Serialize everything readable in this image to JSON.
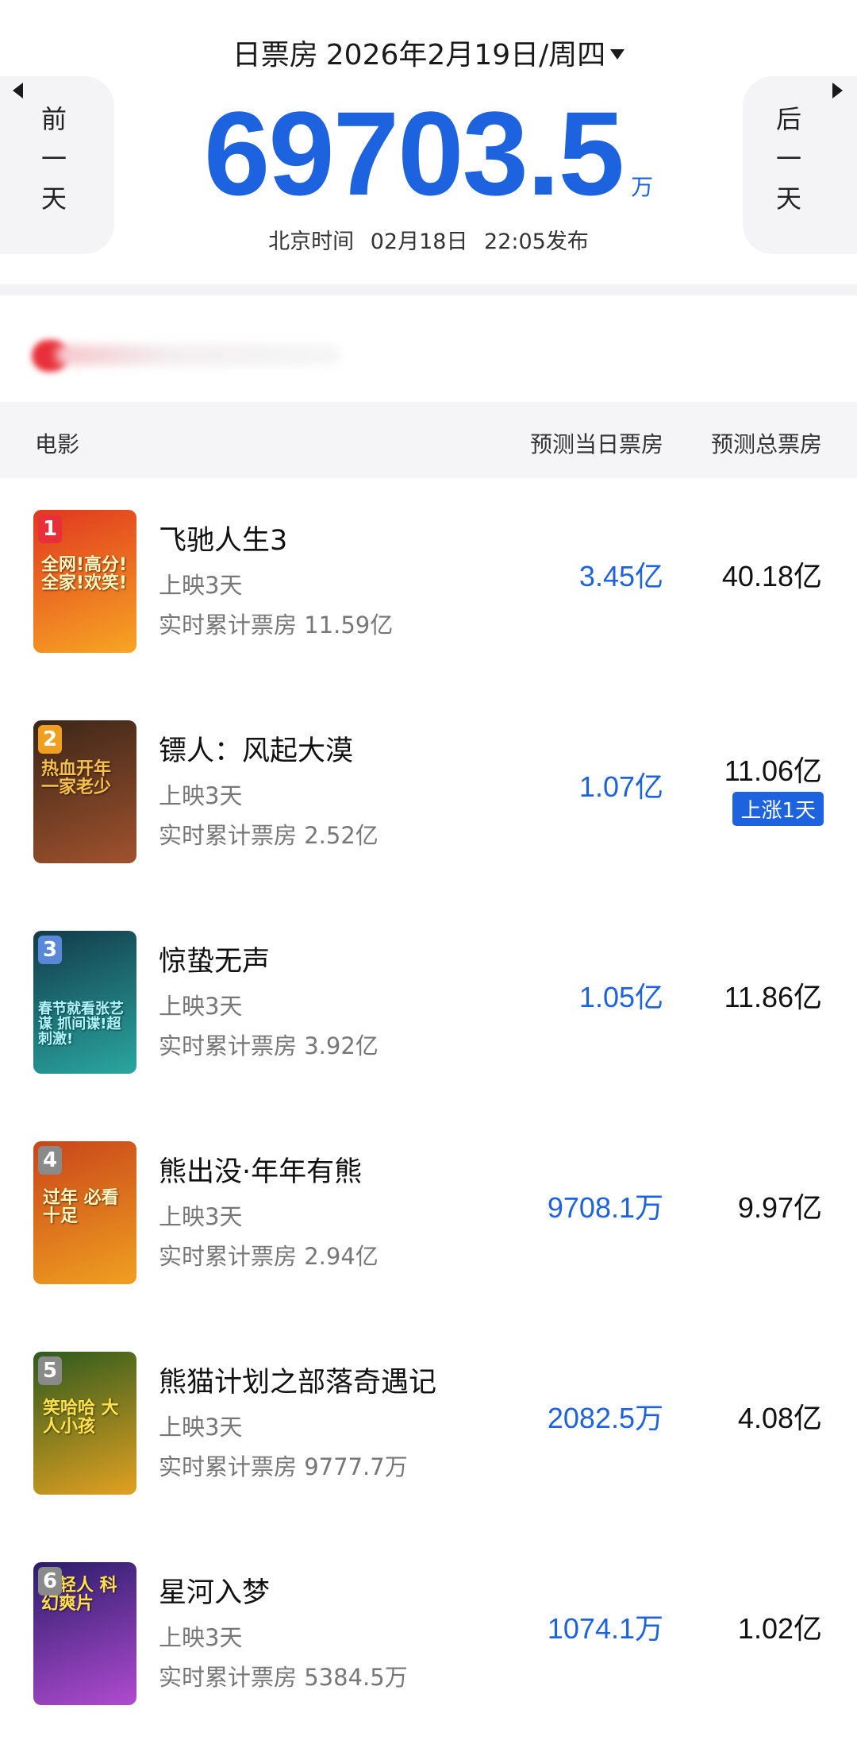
{
  "header": {
    "label": "日票房",
    "date": "2026年2月19日/周四",
    "prev_day": "前一天",
    "next_day": "后一天",
    "total_value": "69703.5",
    "total_unit": "万",
    "publish_prefix": "北京时间",
    "publish_date": "02月18日",
    "publish_time": "22:05发布"
  },
  "table": {
    "col_movie": "电影",
    "col_daily": "预测当日票房",
    "col_total": "预测总票房"
  },
  "movies": [
    {
      "rank": "1",
      "title": "飞驰人生3",
      "days": "上映3天",
      "cumulative": "实时累计票房 11.59亿",
      "daily": "3.45亿",
      "total": "40.18亿",
      "badge": ""
    },
    {
      "rank": "2",
      "title": "镖人：风起大漠",
      "days": "上映3天",
      "cumulative": "实时累计票房 2.52亿",
      "daily": "1.07亿",
      "total": "11.06亿",
      "badge": "上涨1天"
    },
    {
      "rank": "3",
      "title": "惊蛰无声",
      "days": "上映3天",
      "cumulative": "实时累计票房 3.92亿",
      "daily": "1.05亿",
      "total": "11.86亿",
      "badge": ""
    },
    {
      "rank": "4",
      "title": "熊出没·年年有熊",
      "days": "上映3天",
      "cumulative": "实时累计票房 2.94亿",
      "daily": "9708.1万",
      "total": "9.97亿",
      "badge": ""
    },
    {
      "rank": "5",
      "title": "熊猫计划之部落奇遇记",
      "days": "上映3天",
      "cumulative": "实时累计票房 9777.7万",
      "daily": "2082.5万",
      "total": "4.08亿",
      "badge": ""
    },
    {
      "rank": "6",
      "title": "星河入梦",
      "days": "上映3天",
      "cumulative": "实时累计票房 5384.5万",
      "daily": "1074.1万",
      "total": "1.02亿",
      "badge": ""
    }
  ],
  "posters": [
    {
      "caption": "全网!高分!全家!欢笑!",
      "colors": [
        "#e0381f",
        "#f7a623"
      ]
    },
    {
      "caption": "热血开年 一家老少",
      "colors": [
        "#3b2618",
        "#a0522d"
      ]
    },
    {
      "caption": "春节就看张艺谋 抓间谍!超刺激!",
      "colors": [
        "#123a4a",
        "#2aa7a0"
      ]
    },
    {
      "caption": "过年 必看 十足",
      "colors": [
        "#c8451a",
        "#f0a020"
      ]
    },
    {
      "caption": "笑哈哈 大人小孩",
      "colors": [
        "#2e5a1e",
        "#e2a120"
      ]
    },
    {
      "caption": "年轻人 科幻爽片",
      "colors": [
        "#2a1d6a",
        "#b04bd0"
      ]
    }
  ],
  "colors": {
    "accent": "#1d63df",
    "rank1": "#e8303a",
    "rank2": "#f0a020",
    "rank3": "#5a88d8",
    "rank_other": "#8a8a8a"
  }
}
